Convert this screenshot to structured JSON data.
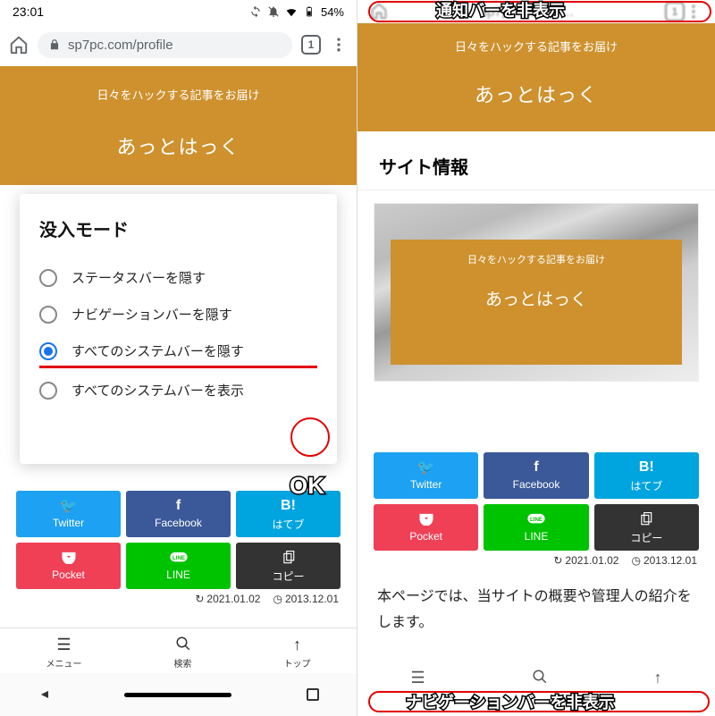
{
  "status": {
    "time": "23:01",
    "battery_pct": "54%"
  },
  "browser": {
    "url": "sp7pc.com/profile",
    "tab_count": "1"
  },
  "orange": {
    "sub": "日々をハックする記事をお届け",
    "title": "あっとはっく"
  },
  "dialog": {
    "title": "没入モード",
    "options": [
      "ステータスバーを隠す",
      "ナビゲーションバーを隠す",
      "すべてのシステムバーを隠す",
      "すべてのシステムバーを表示"
    ],
    "ok": "OK"
  },
  "share": {
    "twitter": "Twitter",
    "facebook": "Facebook",
    "hatebu": "はてブ",
    "pocket": "Pocket",
    "line": "LINE",
    "copy": "コピー"
  },
  "dates": {
    "updated": "2021.01.02",
    "created": "2013.12.01"
  },
  "bottom_nav": {
    "menu": "メニュー",
    "search": "検索",
    "top": "トップ"
  },
  "right": {
    "site_info": "サイト情報",
    "body": "本ページでは、当サイトの概要や管理人の紹介をします。"
  },
  "callout": {
    "top": "通知バーを非表示",
    "bottom": "ナビゲーションバーを非表示"
  }
}
